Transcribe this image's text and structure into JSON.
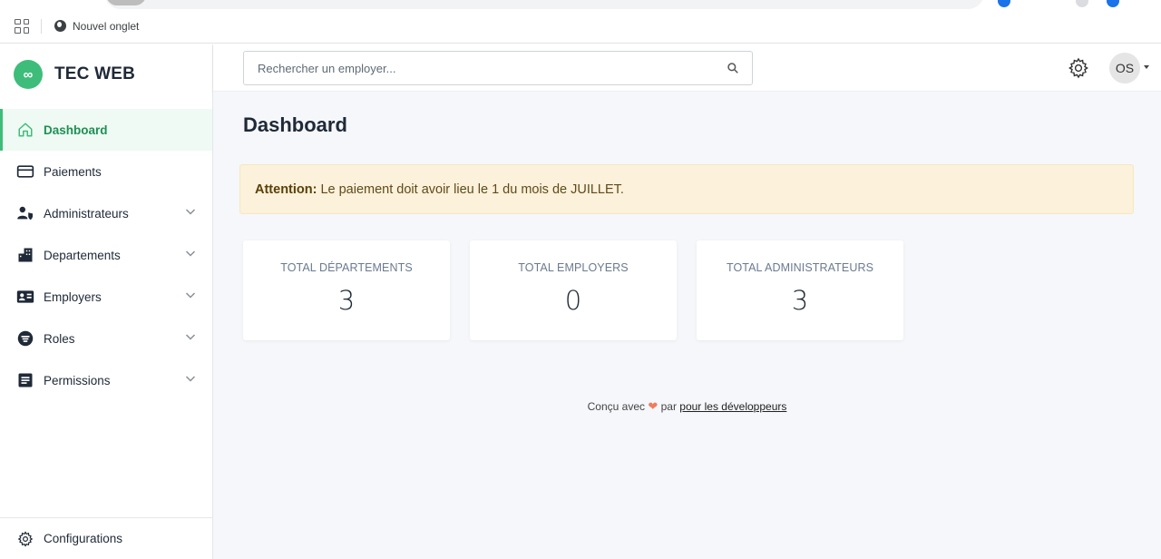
{
  "browser": {
    "bookmark_label": "Nouvel onglet"
  },
  "brand": {
    "logo_glyph": "∞",
    "name": "TEC WEB"
  },
  "sidebar": {
    "items": [
      {
        "label": "Dashboard",
        "icon": "home-icon",
        "active": true
      },
      {
        "label": "Paiements",
        "icon": "credit-card-icon"
      },
      {
        "label": "Administrateurs",
        "icon": "user-shield-icon",
        "expandable": true
      },
      {
        "label": "Departements",
        "icon": "building-icon",
        "expandable": true
      },
      {
        "label": "Employers",
        "icon": "id-card-icon",
        "expandable": true
      },
      {
        "label": "Roles",
        "icon": "roles-icon",
        "expandable": true
      },
      {
        "label": "Permissions",
        "icon": "permissions-icon",
        "expandable": true
      }
    ],
    "config_label": "Configurations"
  },
  "topbar": {
    "search_placeholder": "Rechercher un employer...",
    "avatar_initials": "OS"
  },
  "main": {
    "title": "Dashboard",
    "alert": {
      "strong": "Attention:",
      "text": "Le paiement doit avoir lieu le 1 du mois de JUILLET."
    },
    "cards": [
      {
        "title": "TOTAL DÉPARTEMENTS",
        "value": "3"
      },
      {
        "title": "TOTAL EMPLOYERS",
        "value": "0"
      },
      {
        "title": "TOTAL ADMINISTRATEURS",
        "value": "3"
      }
    ],
    "footer": {
      "prefix": "Conçu avec",
      "heart": "❤",
      "by": "par",
      "link": "pour les développeurs"
    }
  },
  "colors": {
    "accent": "#3ebd7a",
    "alert_bg": "#fcf1da",
    "main_bg": "#f5f7fb"
  }
}
